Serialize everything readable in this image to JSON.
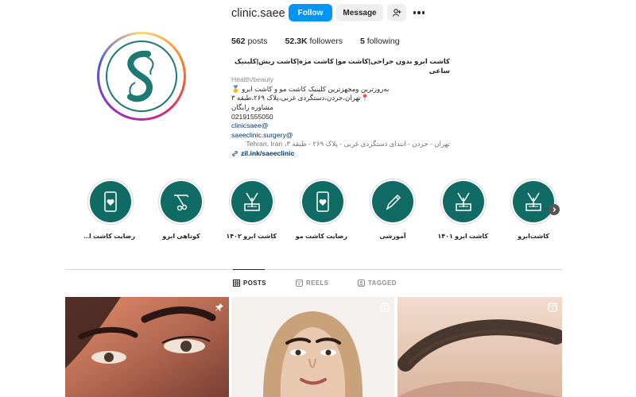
{
  "profile": {
    "username": "clinic.saee",
    "follow_label": "Follow",
    "message_label": "Message",
    "posts_count": "562",
    "posts_label": "posts",
    "followers_count": "52.3K",
    "followers_label": "followers",
    "following_count": "5",
    "following_label": "following"
  },
  "bio": {
    "title": "کاشت ابرو بدون جراحی|کاشت مو| کاشت مژه|کاشت ریش|کلینیک ساعی",
    "category": "Health/beauty",
    "line1": "به‌روزترین ومجهزترین کلینیک کاشت مو و کاشت ابرو 🥇",
    "line2": "📍تهران،جردن،دستگردی غربی،پلاک ۲۶۹،طبقه ۳",
    "line3": "مشاوره رایگان",
    "phone": "02191555050",
    "handle1": "@clinicsaee",
    "handle2": "@saeeclinic.surgery",
    "address": "تهران - جردن - ابتدای دستگردی غربی - پلاک ۲۶۹ - طبقه ۳، Tehran, Iran",
    "url": "zil.ink/saeeclinic"
  },
  "highlights": [
    {
      "label": "رضایت کاشت ا...",
      "icon": "phone-heart-icon"
    },
    {
      "label": "کوتاهی ابرو",
      "icon": "trimmer-icon"
    },
    {
      "label": "کاشت ابرو ۱۴۰۲",
      "icon": "implant-icon"
    },
    {
      "label": "رضایت کاشت مو",
      "icon": "phone-heart-icon"
    },
    {
      "label": "آموزشی",
      "icon": "pencil-icon"
    },
    {
      "label": "کاشت ابرو ۱۴۰۱",
      "icon": "implant-icon"
    },
    {
      "label": "کاشت‌ابرو",
      "icon": "implant-icon"
    }
  ],
  "tabs": {
    "posts": "POSTS",
    "reels": "REELS",
    "tagged": "TAGGED"
  },
  "colors": {
    "accent": "#0095f6",
    "highlight_bg": "#0f6b63",
    "brand_teal": "#1d7a72"
  }
}
